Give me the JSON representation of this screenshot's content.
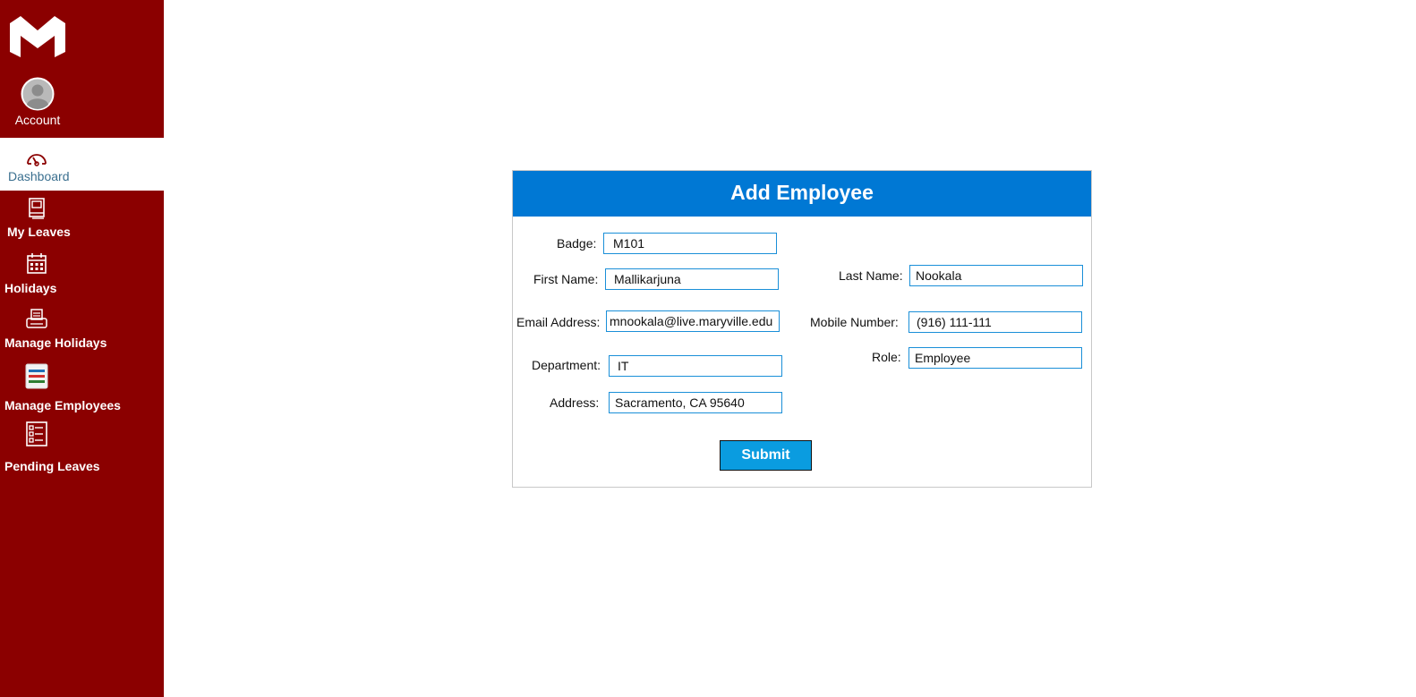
{
  "colors": {
    "sidebar": "#8b0000",
    "header": "#0078d4",
    "submit": "#0a9ce0",
    "input_border": "#1a8fd8",
    "active_label": "#3a6f8f"
  },
  "sidebar": {
    "logo": "maryville-m-logo",
    "account_label": "Account",
    "items": [
      {
        "label": "Dashboard",
        "icon": "speedometer-icon",
        "active": true
      },
      {
        "label": "My Leaves",
        "icon": "notebook-icon"
      },
      {
        "label": "Holidays",
        "icon": "calendar-icon"
      },
      {
        "label": "Manage Holidays",
        "icon": "printer-icon"
      },
      {
        "label": "Manage Employees",
        "icon": "employee-list-icon"
      },
      {
        "label": "Pending Leaves",
        "icon": "checklist-icon"
      }
    ]
  },
  "form": {
    "title": "Add Employee",
    "badge": {
      "label": "Badge:",
      "value": "M101"
    },
    "first_name": {
      "label": "First Name:",
      "value": "Mallikarjuna"
    },
    "last_name": {
      "label": "Last Name:",
      "value": "Nookala"
    },
    "email": {
      "label": "Email Address:",
      "value": "mnookala@live.maryville.edu"
    },
    "mobile": {
      "label": "Mobile Number:",
      "value": "(916) 111-111"
    },
    "department": {
      "label": "Department:",
      "value": "IT"
    },
    "role": {
      "label": "Role:",
      "value": "Employee"
    },
    "address": {
      "label": "Address:",
      "value": "Sacramento, CA 95640"
    },
    "submit_label": "Submit"
  }
}
